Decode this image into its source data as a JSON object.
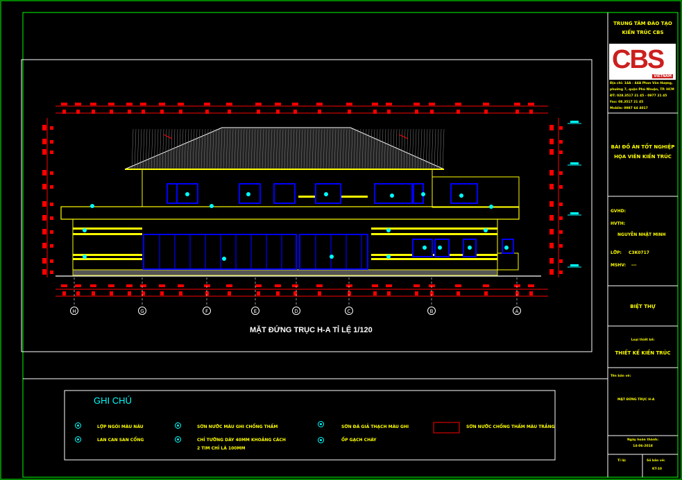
{
  "drawing": {
    "title": "MẶT ĐỨNG TRỤC H-A TỈ LỆ 1/120",
    "grid_axes": [
      "H",
      "G",
      "F",
      "E",
      "D",
      "C",
      "B",
      "A"
    ]
  },
  "title_block": {
    "org_line1": "TRUNG TÂM ĐÀO TẠO",
    "org_line2": "KIẾN TRÚC CBS",
    "logo_text": "CBS",
    "logo_sub": "VIETNAM",
    "address_lines": [
      "Địa chỉ: 14A - 44A Phan Văn Hượng,",
      "phường 7, quận Phú Nhuận, TP. HCM",
      "ĐT: 028.3517 21 45 - 0977 21 45",
      "Fax: 08.3517 21 45",
      "Mobile: 0987 64 4017"
    ],
    "project_line1": "BÀI ĐỒ ÁN TỐT NGHIỆP",
    "project_line2": "HỌA VIÊN KIẾN TRÚC",
    "gvhd_label": "GVHD:",
    "hvth_label": "HVTH:",
    "hvth_value": "NGUYỄN NHẬT MINH",
    "lop_label": "LỚP:",
    "lop_value": "C3K0717",
    "mshv_label": "MSHV:",
    "mshv_value": "---",
    "building": "BIỆT THỰ",
    "design_type_label": "Loại thiết kế:",
    "design_type_value": "THIẾT KẾ KIẾN TRÚC",
    "sheet_name_label": "Tên bản vẽ:",
    "sheet_name_value": "MẶT ĐỨNG TRỤC H-A",
    "date_label": "Ngày hoàn thành:",
    "date_value": "14-06-2018",
    "scale_label": "Tỉ lệ:",
    "sheet_no_label": "Số bản vẽ:",
    "sheet_no_value": "KT-10"
  },
  "legend": {
    "title": "GHI CHÚ",
    "items": [
      {
        "code": "V1",
        "label": "LỢP NGÓI MÀU NÂU"
      },
      {
        "code": "V2",
        "label": "LAN CAN SAN CỔNG"
      },
      {
        "code": "V3",
        "label": "SƠN NƯỚC MÀU GHI CHỐNG THẤM"
      },
      {
        "code": "V4",
        "label": "CHỈ TƯỜNG DÀY 40MM KHOẢNG CÁCH"
      },
      {
        "code": "",
        "label": "2 TIM CHỈ LÀ 100MM"
      },
      {
        "code": "V5",
        "label": "SƠN ĐÁ GIẢ THẠCH MÀU GHI"
      },
      {
        "code": "V6",
        "label": "ỐP GẠCH CHÁY"
      },
      {
        "code": "",
        "label": "SƠN NƯỚC CHỐNG THẤM MÀU TRẮNG"
      }
    ]
  },
  "colors": {
    "background": "#000000",
    "frame": "#00ff00",
    "outline": "#ffffff",
    "building": "#ffff00",
    "windows": "#0000ff",
    "dimensions": "#ff0000",
    "markers": "#00ffff"
  }
}
